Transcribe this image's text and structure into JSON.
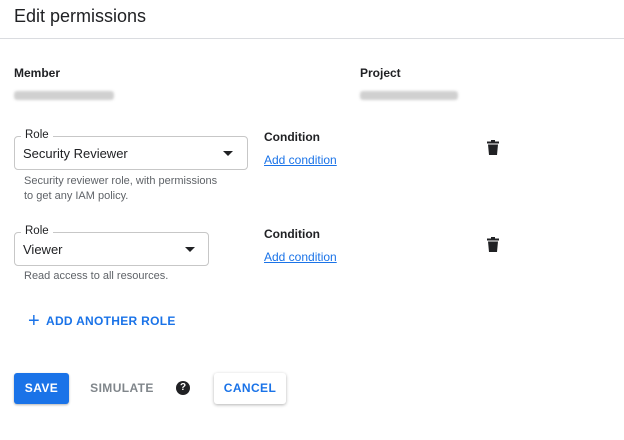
{
  "dialog": {
    "title": "Edit permissions"
  },
  "member": {
    "label": "Member",
    "value_redacted": true
  },
  "project": {
    "label": "Project",
    "value_redacted": true
  },
  "roles": [
    {
      "legend": "Role",
      "selected": "Security Reviewer",
      "hint_line1": "Security reviewer role, with permissions",
      "hint_line2": "to get any IAM policy.",
      "condition_label": "Condition",
      "condition_link": "Add condition"
    },
    {
      "legend": "Role",
      "selected": "Viewer",
      "hint_line1": "Read access to all resources.",
      "condition_label": "Condition",
      "condition_link": "Add condition"
    }
  ],
  "add_role": {
    "label": "ADD ANOTHER ROLE",
    "icon": "plus-icon"
  },
  "actions": {
    "save": "SAVE",
    "simulate": "SIMULATE",
    "help_glyph": "?",
    "cancel": "CANCEL"
  },
  "colors": {
    "accent": "#1a73e8",
    "text": "#202124",
    "secondary_text": "#5f6368",
    "divider": "#dadce0"
  }
}
